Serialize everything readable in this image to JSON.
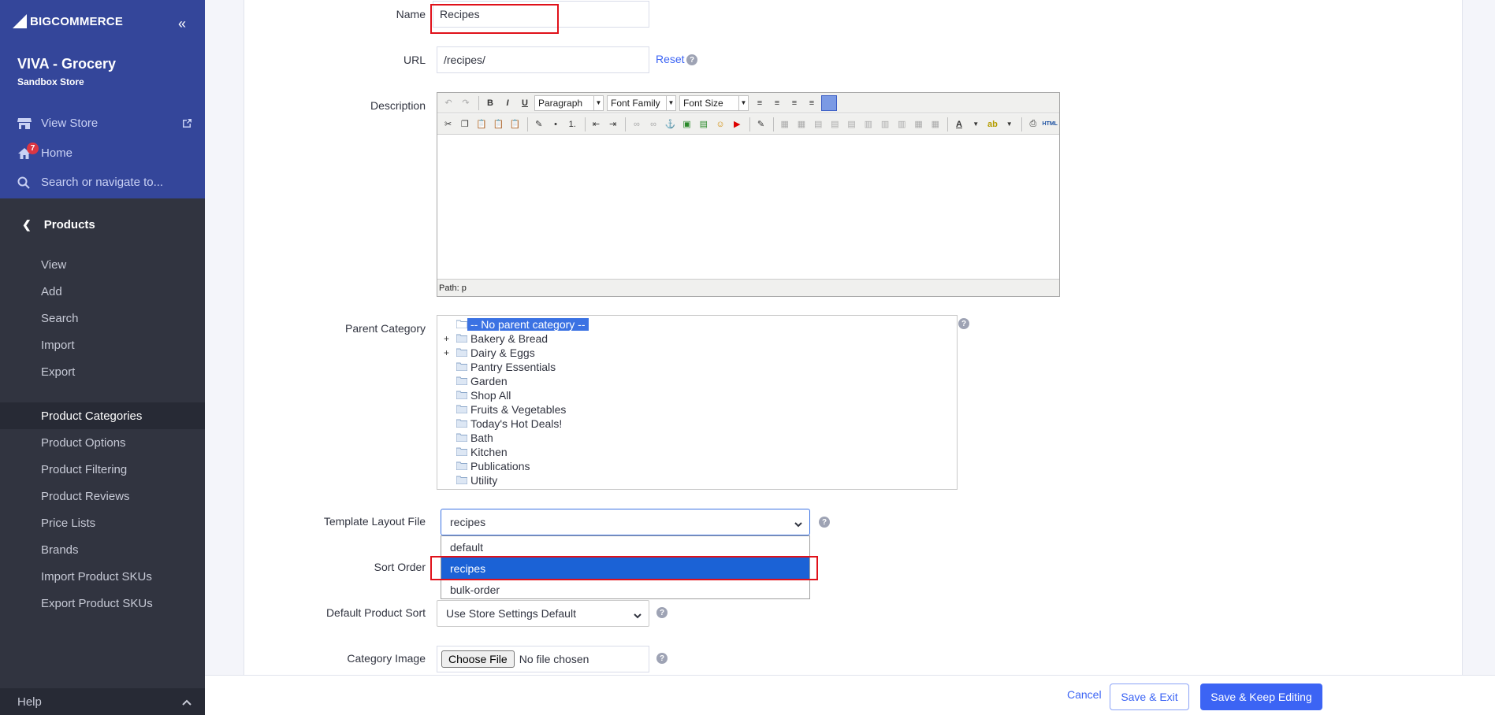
{
  "sidebar": {
    "logo_text": "BIGCOMMERCE",
    "store_name": "VIVA - Grocery",
    "store_sub": "Sandbox Store",
    "view_store": "View Store",
    "home": "Home",
    "home_badge": "7",
    "search": "Search or navigate to...",
    "section": "Products",
    "items": [
      "View",
      "Add",
      "Search",
      "Import",
      "Export"
    ],
    "items2": [
      "Product Categories",
      "Product Options",
      "Product Filtering",
      "Product Reviews",
      "Price Lists",
      "Brands",
      "Import Product SKUs",
      "Export Product SKUs"
    ],
    "help": "Help"
  },
  "form": {
    "name_label": "Name",
    "name_value": "Recipes",
    "url_label": "URL",
    "url_value": "/recipes/",
    "reset": "Reset",
    "description_label": "Description",
    "editor": {
      "paragraph": "Paragraph",
      "font_family": "Font Family",
      "font_size": "Font Size",
      "path": "Path: p"
    },
    "parent_label": "Parent Category",
    "categories": [
      "-- No parent category --",
      "Bakery & Bread",
      "Dairy & Eggs",
      "Pantry Essentials",
      "Garden",
      "Shop All",
      "Fruits & Vegetables",
      "Today's Hot Deals!",
      "Bath",
      "Kitchen",
      "Publications",
      "Utility"
    ],
    "template_label": "Template Layout File",
    "template_value": "recipes",
    "template_options": [
      "default",
      "recipes",
      "bulk-order"
    ],
    "sort_label": "Sort Order",
    "default_sort_label": "Default Product Sort",
    "default_sort_value": "Use Store Settings Default",
    "image_label": "Category Image",
    "choose_file": "Choose File",
    "no_file": "No file chosen"
  },
  "footer": {
    "cancel": "Cancel",
    "save_exit": "Save & Exit",
    "save_keep": "Save & Keep Editing"
  }
}
